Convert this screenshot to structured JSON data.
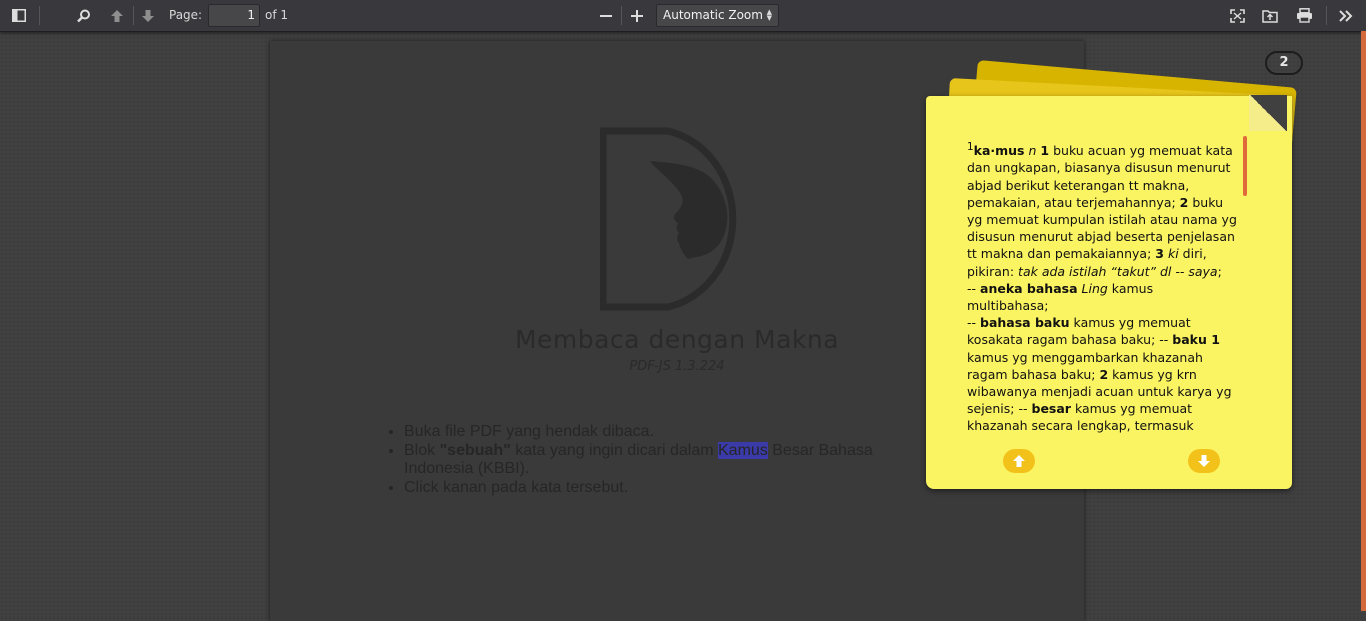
{
  "toolbar": {
    "page_label": "Page:",
    "page_value": "1",
    "page_count": "of 1",
    "zoom_value": "Automatic Zoom",
    "icons": [
      "sidebar-toggle-icon",
      "search-icon",
      "arrow-up-icon",
      "arrow-down-icon",
      "minus-icon",
      "plus-icon",
      "fullscreen-icon",
      "open-folder-icon",
      "print-icon",
      "double-chevron-right-icon"
    ]
  },
  "document": {
    "title": "Membaca dengan Makna",
    "version": "PDF-JS 1.3.224",
    "instructions": {
      "item1": "Buka file PDF yang hendak dibaca.",
      "item2_prefix": "Blok ",
      "item2_bold": "\"sebuah\"",
      "item2_mid": " kata yang ingin dicari dalam ",
      "item2_highlight": "Kamus",
      "item2_suffix": " Besar Bahasa Indonesia (KBBI).",
      "item3": "Click kanan pada kata tersebut."
    }
  },
  "page_badge": "2",
  "dictionary": {
    "sup": "1",
    "headword": "ka·mus",
    "pos": "n",
    "n1": "1",
    "def1": "buku acuan yg memuat kata dan ungkapan, biasanya disusun menurut abjad berikut keterangan tt makna, pemakaian, atau terjemahannya;",
    "n2": "2",
    "def2": "buku yg memuat kumpulan istilah atau nama yg disusun menurut abjad beserta penjelasan tt makna dan pemakaiannya;",
    "n3": "3",
    "pos3": "ki",
    "def3": "diri, pikiran:",
    "ex3": "tak ada istilah “takut” dl -- saya",
    "sub1_dash": "--",
    "sub1_bold": "aneka bahasa",
    "sub1_label": "Ling",
    "sub1_def": "kamus multibahasa;",
    "sub2_dash": "--",
    "sub2_bold": "bahasa baku",
    "sub2_def": "kamus yg memuat kosakata ragam bahasa baku;",
    "sub3_dash": "--",
    "sub3_bold": "baku 1",
    "sub3_def": "kamus yg menggambarkan khazanah ragam bahasa baku;",
    "sub3_n2": "2",
    "sub3_def2": "kamus yg krn wibawanya menjadi acuan untuk karya yg sejenis;",
    "sub4_dash": "--",
    "sub4_bold": "besar",
    "sub4_def": "kamus yg memuat khazanah secara lengkap, termasuk kosakata istilah dr berbagai bidang ilmu"
  },
  "colors": {
    "note_yellow": "#fbf462",
    "nav_button": "#f3c21a",
    "highlight": "#3a3aa8",
    "accent_orange": "#d26a3e"
  }
}
